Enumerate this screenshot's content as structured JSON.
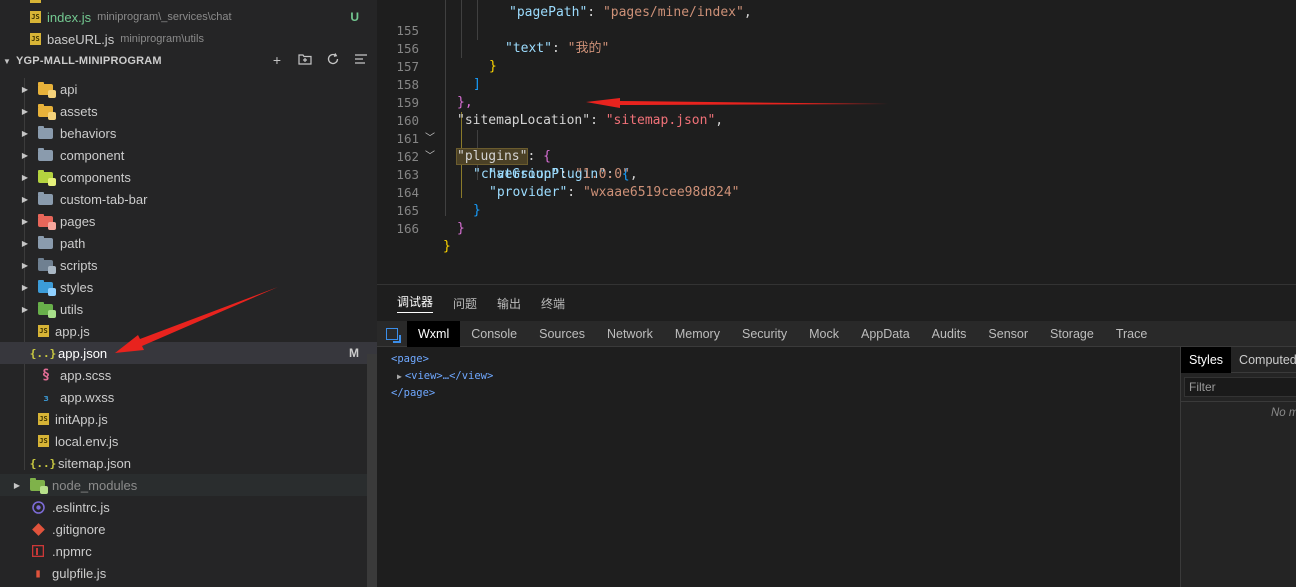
{
  "explorer": {
    "open_files": [
      {
        "name": "index.js",
        "path": "miniprogram\\_services\\chat",
        "git": "U",
        "icon": "js-file-icon"
      },
      {
        "name": "baseURL.js",
        "path": "miniprogram\\utils",
        "git": "",
        "icon": "js-file-icon"
      }
    ],
    "project": {
      "title": "YGP-MALL-MINIPROGRAM",
      "actions": [
        "new-file-icon",
        "new-folder-icon",
        "refresh-icon",
        "collapse-all-icon"
      ]
    },
    "tree": [
      {
        "name": "api",
        "type": "folder",
        "color": "#e8b23a",
        "badge": "#e8b23a"
      },
      {
        "name": "assets",
        "type": "folder",
        "color": "#e8b23a",
        "badge": "#e8b23a"
      },
      {
        "name": "behaviors",
        "type": "folder",
        "color": "#8a9bad"
      },
      {
        "name": "component",
        "type": "folder",
        "color": "#8a9bad"
      },
      {
        "name": "components",
        "type": "folder",
        "color": "#b4d33f",
        "badge": "#b4d33f"
      },
      {
        "name": "custom-tab-bar",
        "type": "folder",
        "color": "#8a9bad"
      },
      {
        "name": "pages",
        "type": "folder",
        "color": "#e8665a",
        "badge": "#e8665a"
      },
      {
        "name": "path",
        "type": "folder",
        "color": "#8a9bad"
      },
      {
        "name": "scripts",
        "type": "folder",
        "color": "#8a9bad",
        "badge": "#5a6f85"
      },
      {
        "name": "styles",
        "type": "folder",
        "color": "#3c9cd8",
        "badge": "#3c9cd8"
      },
      {
        "name": "utils",
        "type": "folder",
        "color": "#68b04a",
        "badge": "#68b04a"
      },
      {
        "name": "app.js",
        "type": "js"
      },
      {
        "name": "app.json",
        "type": "json",
        "git": "M",
        "selected": true
      },
      {
        "name": "app.scss",
        "type": "scss"
      },
      {
        "name": "app.wxss",
        "type": "wxss"
      },
      {
        "name": "initApp.js",
        "type": "js"
      },
      {
        "name": "local.env.js",
        "type": "js"
      },
      {
        "name": "sitemap.json",
        "type": "json"
      }
    ],
    "root_items": [
      {
        "name": "node_modules",
        "type": "folder-nm"
      },
      {
        "name": ".eslintrc.js",
        "type": "eslint"
      },
      {
        "name": ".gitignore",
        "type": "git"
      },
      {
        "name": ".npmrc",
        "type": "npm"
      },
      {
        "name": "gulpfile.js",
        "type": "gulp"
      }
    ],
    "colors": {
      "untracked": "#73c991",
      "modified": "#e2c08d"
    }
  },
  "editor": {
    "lines": [
      {
        "n": "155",
        "text_key": "\"text\"",
        "text_val": "\"我的\""
      },
      {
        "n": "156",
        "brace": "}"
      },
      {
        "n": "157",
        "brace": "]"
      },
      {
        "n": "158",
        "brace": "},"
      },
      {
        "n": "159",
        "key": "\"sitemapLocation\"",
        "val": "\"sitemap.json\""
      },
      {
        "n": "160",
        "key": "\"plugins\"",
        "open": "{"
      },
      {
        "n": "161",
        "key": "\"chatGroupPlugin\"",
        "open": "{"
      },
      {
        "n": "162",
        "key": "\"version\"",
        "val": "\"1.0.0\""
      },
      {
        "n": "163",
        "key": "\"provider\"",
        "val": "\"wxaae6519cee98d824\""
      },
      {
        "n": "164",
        "brace": "}"
      },
      {
        "n": "165",
        "brace": "}"
      },
      {
        "n": "166",
        "brace": "}"
      }
    ]
  },
  "debugger": {
    "top_tabs": [
      "调试器",
      "问题",
      "输出",
      "终端"
    ],
    "devtools_tabs": [
      "Wxml",
      "Console",
      "Sources",
      "Network",
      "Memory",
      "Security",
      "Mock",
      "AppData",
      "Audits",
      "Sensor",
      "Storage",
      "Trace"
    ],
    "wxml": {
      "open": "<page>",
      "child": "<view>…</view>",
      "close": "</page>"
    },
    "styles": {
      "tabs": [
        "Styles",
        "Computed"
      ],
      "filter_placeholder": "Filter",
      "empty": "No m"
    }
  },
  "annotation_color": "#e8231e"
}
